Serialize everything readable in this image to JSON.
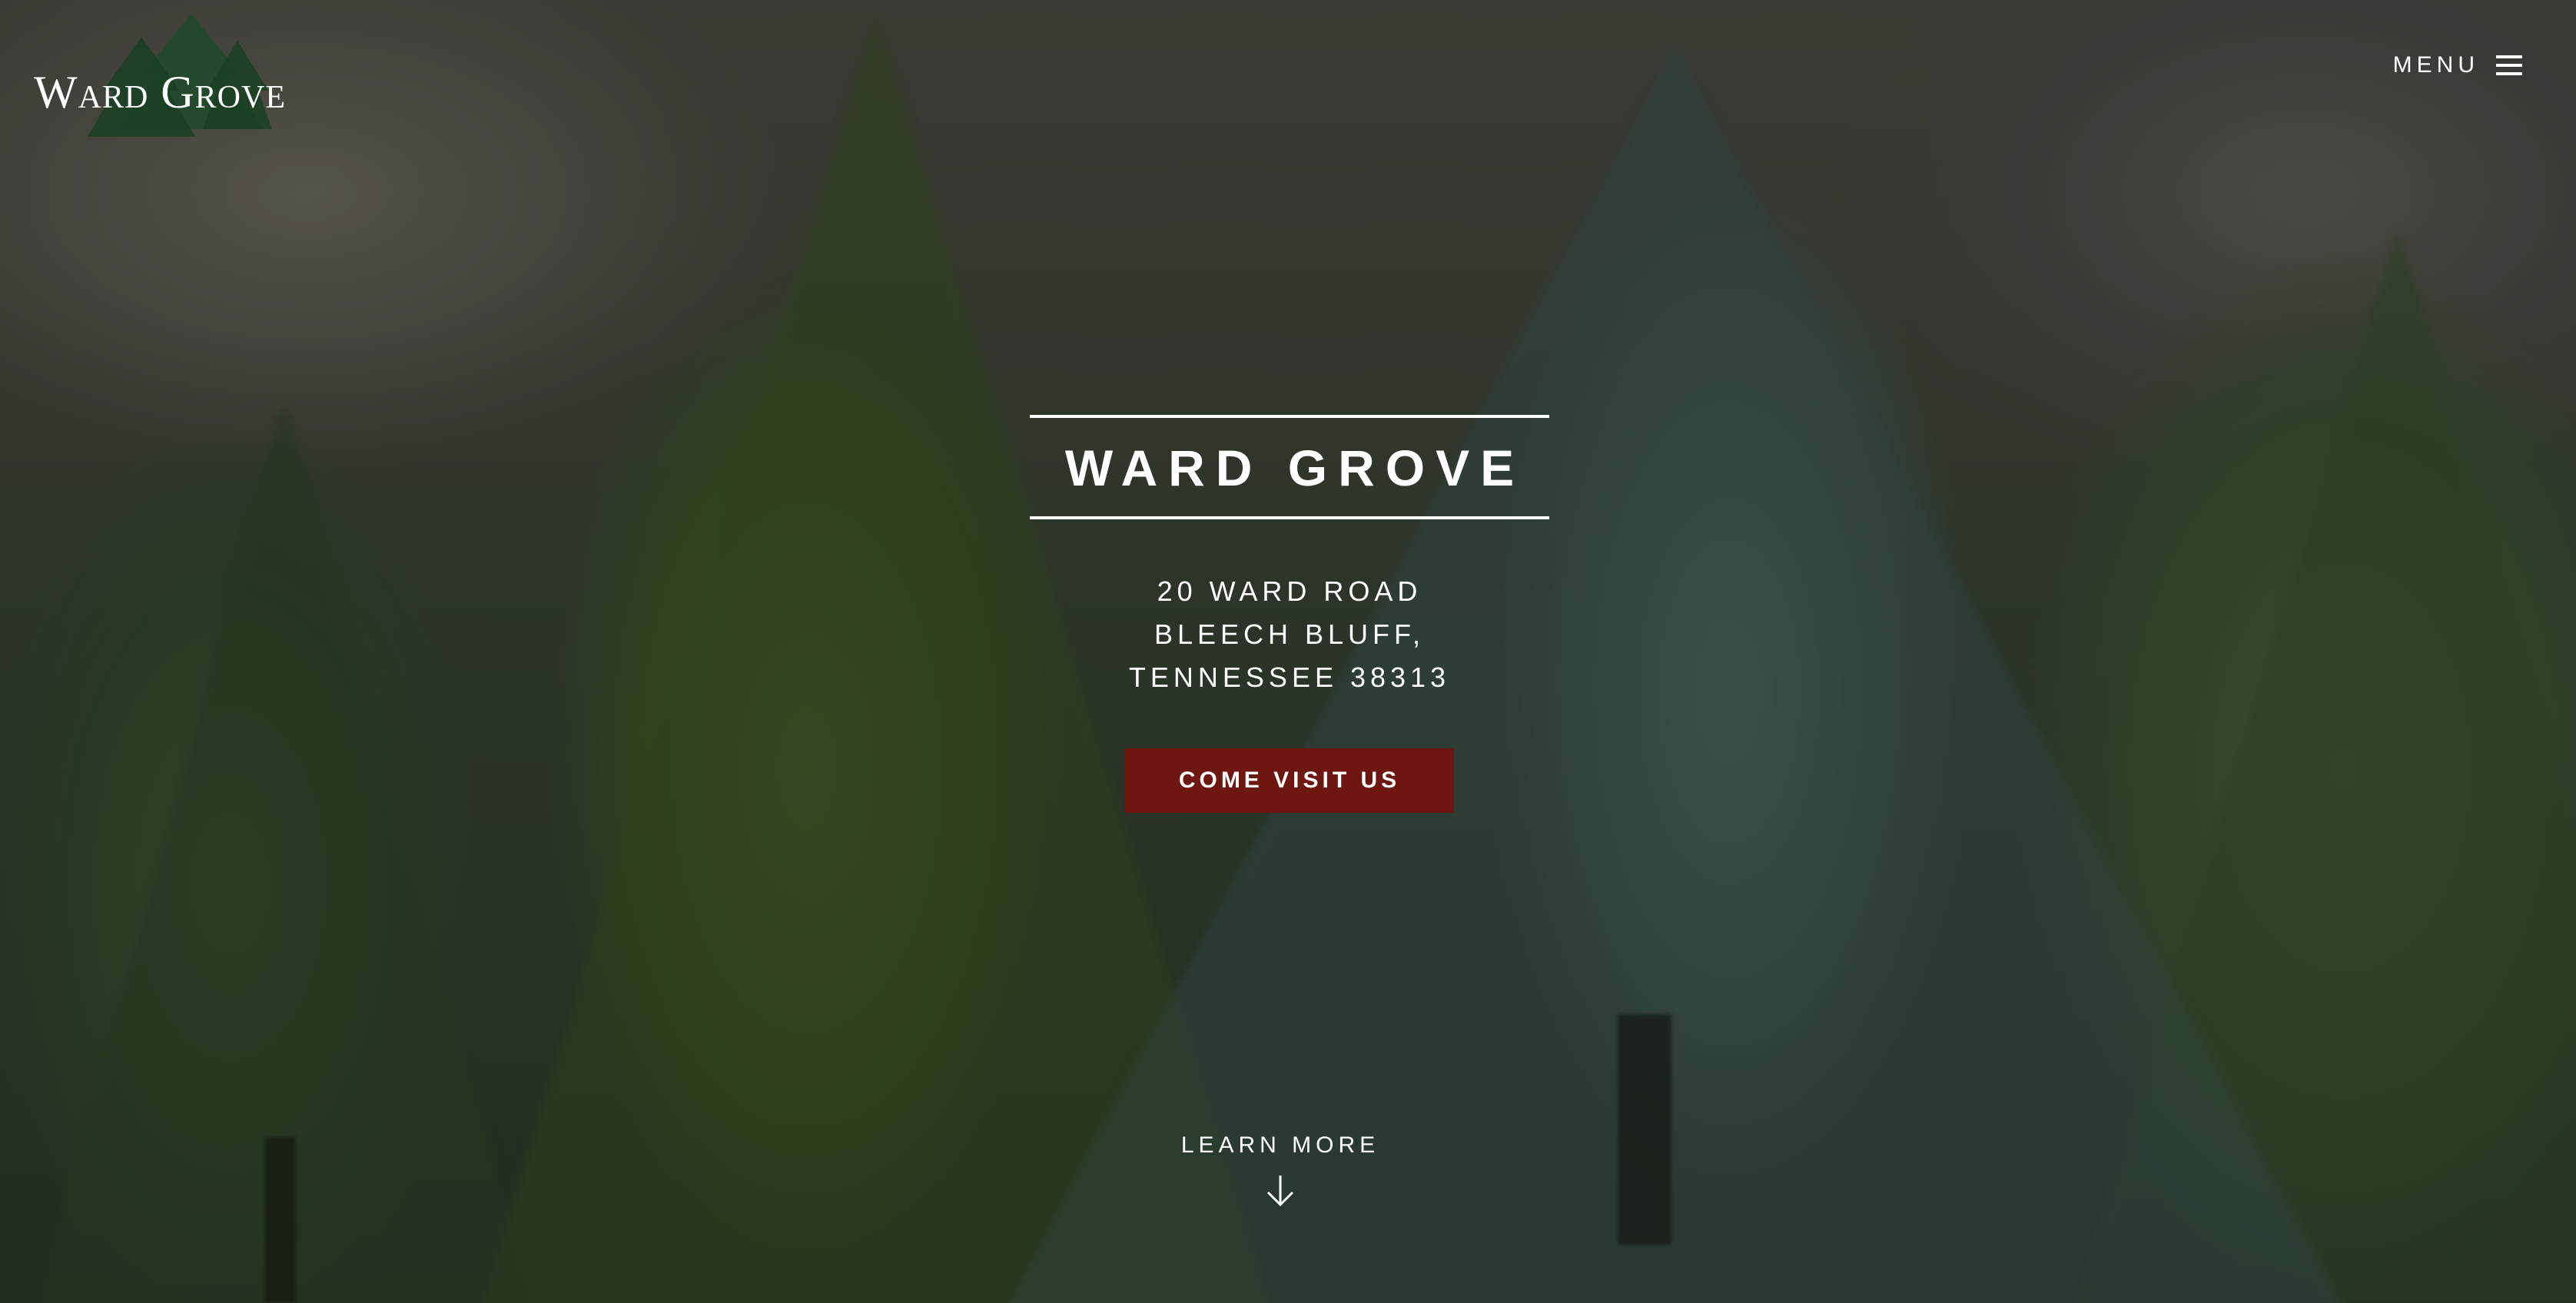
{
  "brand": {
    "logo_text": "Ward Grove",
    "accent_color": "#6e1710",
    "logo_tree_color": "#1f4a2a"
  },
  "nav": {
    "menu_label": "MENU"
  },
  "hero": {
    "title": "WARD GROVE",
    "address": {
      "line1": "20 WARD ROAD",
      "line2": "BLEECH BLUFF,",
      "line3": "TENNESSEE 38313"
    },
    "cta_label": "COME VISIT US",
    "learn_more_label": "LEARN MORE"
  },
  "icons": {
    "menu": "hamburger-icon",
    "learn_more": "arrow-down-icon"
  }
}
